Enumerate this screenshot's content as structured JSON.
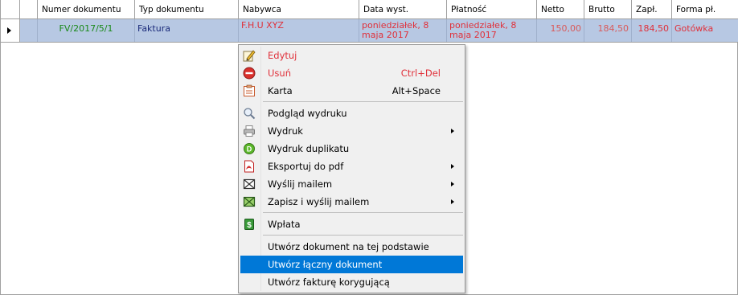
{
  "table": {
    "columns": [
      "Numer dokumentu",
      "Typ dokumentu",
      "Nabywca",
      "Data wyst.",
      "Płatność",
      "Netto",
      "Brutto",
      "Zapł.",
      "Forma pł."
    ],
    "row": {
      "numer": "FV/2017/5/1",
      "typ": "Faktura",
      "nabywca": "F.H.U XYZ",
      "data_wyst": "poniedziałek, 8 maja 2017",
      "platnosc": "poniedziałek, 8 maja 2017",
      "netto": "150,00",
      "brutto": "184,50",
      "zapl": "184,50",
      "forma": "Gotówka"
    }
  },
  "menu": {
    "edit": {
      "label": "Edytuj",
      "icon": "edit-icon"
    },
    "delete": {
      "label": "Usuń",
      "shortcut": "Ctrl+Del",
      "icon": "delete-icon"
    },
    "card": {
      "label": "Karta",
      "shortcut": "Alt+Space",
      "icon": "card-icon"
    },
    "preview": {
      "label": "Podgląd wydruku",
      "icon": "magnifier-icon"
    },
    "print": {
      "label": "Wydruk",
      "icon": "printer-icon"
    },
    "print_dup": {
      "label": "Wydruk duplikatu",
      "icon": "duplicate-icon"
    },
    "export_pdf": {
      "label": "Eksportuj do pdf",
      "icon": "pdf-icon"
    },
    "send_mail": {
      "label": "Wyślij mailem",
      "icon": "mail-icon"
    },
    "save_send": {
      "label": "Zapisz i wyślij mailem",
      "icon": "mail-save-icon"
    },
    "payment": {
      "label": "Wpłata",
      "icon": "payment-icon"
    },
    "create_based": {
      "label": "Utwórz dokument na tej podstawie"
    },
    "create_combined": {
      "label": "Utwórz łączny dokument"
    },
    "create_correction": {
      "label": "Utwórz fakturę korygującą"
    }
  },
  "colors": {
    "row_selected": "#b7c8e3",
    "menu_highlight": "#0078d7",
    "red_text": "#e0303a",
    "green_text": "#1a8a1a"
  }
}
